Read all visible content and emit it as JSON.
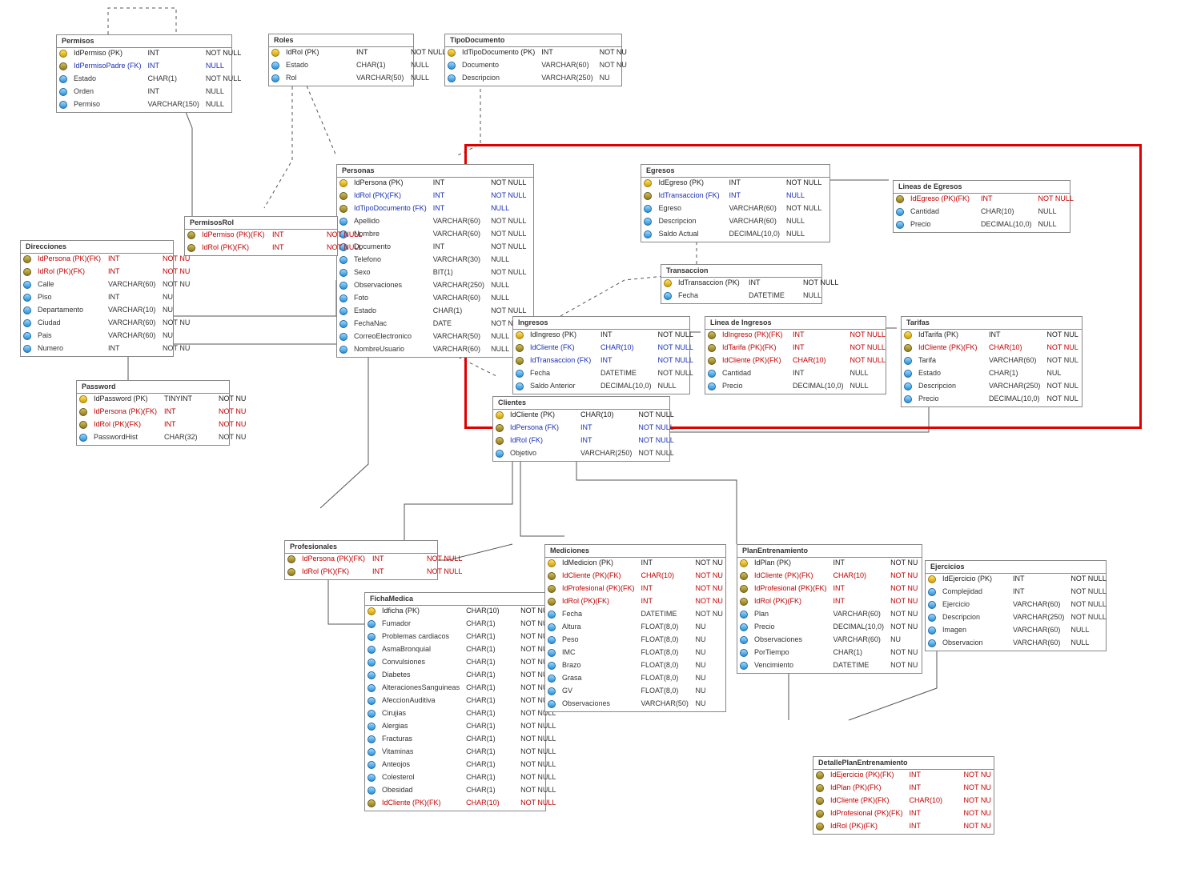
{
  "t": {
    "permisos": {
      "name": "Permisos",
      "c": [
        {
          "k": "pk",
          "n": "IdPermiso (PK)",
          "t": "INT",
          "x": "NOT NULL"
        },
        {
          "k": "fk",
          "n": "IdPermisoPadre (FK)",
          "t": "INT",
          "x": "NULL"
        },
        {
          "k": "a",
          "n": "Estado",
          "t": "CHAR(1)",
          "x": "NOT NULL"
        },
        {
          "k": "a",
          "n": "Orden",
          "t": "INT",
          "x": "NULL"
        },
        {
          "k": "a",
          "n": "Permiso",
          "t": "VARCHAR(150)",
          "x": "NULL"
        }
      ]
    },
    "roles": {
      "name": "Roles",
      "c": [
        {
          "k": "pk",
          "n": "IdRol (PK)",
          "t": "INT",
          "x": "NOT NULL"
        },
        {
          "k": "a",
          "n": "Estado",
          "t": "CHAR(1)",
          "x": "NULL"
        },
        {
          "k": "a",
          "n": "Rol",
          "t": "VARCHAR(50)",
          "x": "NULL"
        }
      ]
    },
    "tipodocumento": {
      "name": "TipoDocumento",
      "c": [
        {
          "k": "pk",
          "n": "IdTipoDocumento (PK)",
          "t": "INT",
          "x": "NOT NU"
        },
        {
          "k": "a",
          "n": "Documento",
          "t": "VARCHAR(60)",
          "x": "NOT NU"
        },
        {
          "k": "a",
          "n": "Descripcion",
          "t": "VARCHAR(250)",
          "x": "NU"
        }
      ]
    },
    "personas": {
      "name": "Personas",
      "c": [
        {
          "k": "pk",
          "n": "IdPersona (PK)",
          "t": "INT",
          "x": "NOT NULL"
        },
        {
          "k": "fk",
          "n": "IdRol (PK)(FK)",
          "t": "INT",
          "x": "NOT NULL"
        },
        {
          "k": "fk",
          "n": "IdTipoDocumento (FK)",
          "t": "INT",
          "x": "NULL"
        },
        {
          "k": "a",
          "n": "Apellido",
          "t": "VARCHAR(60)",
          "x": "NOT NULL"
        },
        {
          "k": "a",
          "n": "Nombre",
          "t": "VARCHAR(60)",
          "x": "NOT NULL"
        },
        {
          "k": "a",
          "n": "Documento",
          "t": "INT",
          "x": "NOT NULL"
        },
        {
          "k": "a",
          "n": "Telefono",
          "t": "VARCHAR(30)",
          "x": "NULL"
        },
        {
          "k": "a",
          "n": "Sexo",
          "t": "BIT(1)",
          "x": "NOT NULL"
        },
        {
          "k": "a",
          "n": "Observaciones",
          "t": "VARCHAR(250)",
          "x": "NULL"
        },
        {
          "k": "a",
          "n": "Foto",
          "t": "VARCHAR(60)",
          "x": "NULL"
        },
        {
          "k": "a",
          "n": "Estado",
          "t": "CHAR(1)",
          "x": "NOT NULL"
        },
        {
          "k": "a",
          "n": "FechaNac",
          "t": "DATE",
          "x": "NOT NULL"
        },
        {
          "k": "a",
          "n": "CorreoElectronico",
          "t": "VARCHAR(50)",
          "x": "NULL"
        },
        {
          "k": "a",
          "n": "NombreUsuario",
          "t": "VARCHAR(60)",
          "x": "NULL"
        }
      ]
    },
    "permisosrol": {
      "name": "PermisosRol",
      "c": [
        {
          "k": "fr",
          "n": "IdPermiso (PK)(FK)",
          "t": "INT",
          "x": "NOT NULL"
        },
        {
          "k": "fr",
          "n": "IdRol (PK)(FK)",
          "t": "INT",
          "x": "NOT NULL"
        }
      ]
    },
    "direcciones": {
      "name": "Direcciones",
      "c": [
        {
          "k": "fr",
          "n": "IdPersona (PK)(FK)",
          "t": "INT",
          "x": "NOT NU"
        },
        {
          "k": "fr",
          "n": "IdRol (PK)(FK)",
          "t": "INT",
          "x": "NOT NU"
        },
        {
          "k": "a",
          "n": "Calle",
          "t": "VARCHAR(60)",
          "x": "NOT NU"
        },
        {
          "k": "a",
          "n": "Piso",
          "t": "INT",
          "x": "NU"
        },
        {
          "k": "a",
          "n": "Departamento",
          "t": "VARCHAR(10)",
          "x": "NU"
        },
        {
          "k": "a",
          "n": "Ciudad",
          "t": "VARCHAR(60)",
          "x": "NOT NU"
        },
        {
          "k": "a",
          "n": "Pais",
          "t": "VARCHAR(60)",
          "x": "NU"
        },
        {
          "k": "a",
          "n": "Numero",
          "t": "INT",
          "x": "NOT NU"
        }
      ]
    },
    "password": {
      "name": "Password",
      "c": [
        {
          "k": "pk",
          "n": "IdPassword (PK)",
          "t": "TINYINT",
          "x": "NOT NU"
        },
        {
          "k": "fr",
          "n": "IdPersona (PK)(FK)",
          "t": "INT",
          "x": "NOT NU"
        },
        {
          "k": "fr",
          "n": "IdRol (PK)(FK)",
          "t": "INT",
          "x": "NOT NU"
        },
        {
          "k": "a",
          "n": "PasswordHist",
          "t": "CHAR(32)",
          "x": "NOT NU"
        }
      ]
    },
    "egresos": {
      "name": "Egresos",
      "c": [
        {
          "k": "pk",
          "n": "IdEgreso (PK)",
          "t": "INT",
          "x": "NOT NULL"
        },
        {
          "k": "fk",
          "n": "IdTransaccion (FK)",
          "t": "INT",
          "x": "NULL"
        },
        {
          "k": "a",
          "n": "Egreso",
          "t": "VARCHAR(60)",
          "x": "NOT NULL"
        },
        {
          "k": "a",
          "n": "Descripcion",
          "t": "VARCHAR(60)",
          "x": "NULL"
        },
        {
          "k": "a",
          "n": "Saldo Actual",
          "t": "DECIMAL(10,0)",
          "x": "NULL"
        }
      ]
    },
    "lineasegresos": {
      "name": "Lineas de Egresos",
      "c": [
        {
          "k": "fr",
          "n": "IdEgreso (PK)(FK)",
          "t": "INT",
          "x": "NOT NULL"
        },
        {
          "k": "a",
          "n": "Cantidad",
          "t": "CHAR(10)",
          "x": "NULL"
        },
        {
          "k": "a",
          "n": "Precio",
          "t": "DECIMAL(10,0)",
          "x": "NULL"
        }
      ]
    },
    "transaccion": {
      "name": "Transaccion",
      "c": [
        {
          "k": "pk",
          "n": "IdTransaccion (PK)",
          "t": "INT",
          "x": "NOT NULL"
        },
        {
          "k": "a",
          "n": "Fecha",
          "t": "DATETIME",
          "x": "NULL"
        }
      ]
    },
    "ingresos": {
      "name": "Ingresos",
      "c": [
        {
          "k": "pk",
          "n": "IdIngreso (PK)",
          "t": "INT",
          "x": "NOT NULL"
        },
        {
          "k": "fk",
          "n": "IdCliente (FK)",
          "t": "CHAR(10)",
          "x": "NOT NULL"
        },
        {
          "k": "fk",
          "n": "IdTransaccion (FK)",
          "t": "INT",
          "x": "NOT NULL"
        },
        {
          "k": "a",
          "n": "Fecha",
          "t": "DATETIME",
          "x": "NOT NULL"
        },
        {
          "k": "a",
          "n": "Saldo Anterior",
          "t": "DECIMAL(10,0)",
          "x": "NULL"
        }
      ]
    },
    "lineaingresos": {
      "name": "Linea de Ingresos",
      "c": [
        {
          "k": "fr",
          "n": "IdIngreso (PK)(FK)",
          "t": "INT",
          "x": "NOT NULL"
        },
        {
          "k": "fr",
          "n": "IdTarifa (PK)(FK)",
          "t": "INT",
          "x": "NOT NULL"
        },
        {
          "k": "fr",
          "n": "IdCliente (PK)(FK)",
          "t": "CHAR(10)",
          "x": "NOT NULL"
        },
        {
          "k": "a",
          "n": "Cantidad",
          "t": "INT",
          "x": "NULL"
        },
        {
          "k": "a",
          "n": "Precio",
          "t": "DECIMAL(10,0)",
          "x": "NULL"
        }
      ]
    },
    "tarifas": {
      "name": "Tarifas",
      "c": [
        {
          "k": "pk",
          "n": "IdTarifa (PK)",
          "t": "INT",
          "x": "NOT NUL"
        },
        {
          "k": "fr",
          "n": "IdCliente (PK)(FK)",
          "t": "CHAR(10)",
          "x": "NOT NUL"
        },
        {
          "k": "a",
          "n": "Tarifa",
          "t": "VARCHAR(60)",
          "x": "NOT NUL"
        },
        {
          "k": "a",
          "n": "Estado",
          "t": "CHAR(1)",
          "x": "NUL"
        },
        {
          "k": "a",
          "n": "Descripcion",
          "t": "VARCHAR(250)",
          "x": "NOT NUL"
        },
        {
          "k": "a",
          "n": "Precio",
          "t": "DECIMAL(10,0)",
          "x": "NOT NUL"
        }
      ]
    },
    "clientes": {
      "name": "Clientes",
      "c": [
        {
          "k": "pk",
          "n": "IdCliente (PK)",
          "t": "CHAR(10)",
          "x": "NOT NULL"
        },
        {
          "k": "fk",
          "n": "IdPersona (FK)",
          "t": "INT",
          "x": "NOT NULL"
        },
        {
          "k": "fk",
          "n": "IdRol (FK)",
          "t": "INT",
          "x": "NOT NULL"
        },
        {
          "k": "a",
          "n": "Objetivo",
          "t": "VARCHAR(250)",
          "x": "NOT NULL"
        }
      ]
    },
    "profesionales": {
      "name": "Profesionales",
      "c": [
        {
          "k": "fr",
          "n": "IdPersona (PK)(FK)",
          "t": "INT",
          "x": "NOT NULL"
        },
        {
          "k": "fr",
          "n": "IdRol (PK)(FK)",
          "t": "INT",
          "x": "NOT NULL"
        }
      ]
    },
    "fichamedica": {
      "name": "FichaMedica",
      "c": [
        {
          "k": "pk",
          "n": "Idficha (PK)",
          "t": "CHAR(10)",
          "x": "NOT NULL"
        },
        {
          "k": "a",
          "n": "Fumador",
          "t": "CHAR(1)",
          "x": "NOT NULL"
        },
        {
          "k": "a",
          "n": "Problemas cardiacos",
          "t": "CHAR(1)",
          "x": "NOT NULL"
        },
        {
          "k": "a",
          "n": "AsmaBronquial",
          "t": "CHAR(1)",
          "x": "NOT NULL"
        },
        {
          "k": "a",
          "n": "Convulsiones",
          "t": "CHAR(1)",
          "x": "NOT NULL"
        },
        {
          "k": "a",
          "n": "Diabetes",
          "t": "CHAR(1)",
          "x": "NOT NULL"
        },
        {
          "k": "a",
          "n": "AlteracionesSanguineas",
          "t": "CHAR(1)",
          "x": "NOT NULL"
        },
        {
          "k": "a",
          "n": "AfeccionAuditiva",
          "t": "CHAR(1)",
          "x": "NOT NULL"
        },
        {
          "k": "a",
          "n": "Cirujias",
          "t": "CHAR(1)",
          "x": "NOT NULL"
        },
        {
          "k": "a",
          "n": "Alergias",
          "t": "CHAR(1)",
          "x": "NOT NULL"
        },
        {
          "k": "a",
          "n": "Fracturas",
          "t": "CHAR(1)",
          "x": "NOT NULL"
        },
        {
          "k": "a",
          "n": "Vitaminas",
          "t": "CHAR(1)",
          "x": "NOT NULL"
        },
        {
          "k": "a",
          "n": "Anteojos",
          "t": "CHAR(1)",
          "x": "NOT NULL"
        },
        {
          "k": "a",
          "n": "Colesterol",
          "t": "CHAR(1)",
          "x": "NOT NULL"
        },
        {
          "k": "a",
          "n": "Obesidad",
          "t": "CHAR(1)",
          "x": "NOT NULL"
        },
        {
          "k": "fr",
          "n": "IdCliente (PK)(FK)",
          "t": "CHAR(10)",
          "x": "NOT NULL"
        }
      ]
    },
    "mediciones": {
      "name": "Mediciones",
      "c": [
        {
          "k": "pk",
          "n": "IdMedicion (PK)",
          "t": "INT",
          "x": "NOT NU"
        },
        {
          "k": "fr",
          "n": "IdCliente (PK)(FK)",
          "t": "CHAR(10)",
          "x": "NOT NU"
        },
        {
          "k": "fr",
          "n": "IdProfesional (PK)(FK)",
          "t": "INT",
          "x": "NOT NU"
        },
        {
          "k": "fr",
          "n": "IdRol (PK)(FK)",
          "t": "INT",
          "x": "NOT NU"
        },
        {
          "k": "a",
          "n": "Fecha",
          "t": "DATETIME",
          "x": "NOT NU"
        },
        {
          "k": "a",
          "n": "Altura",
          "t": "FLOAT(8,0)",
          "x": "NU"
        },
        {
          "k": "a",
          "n": "Peso",
          "t": "FLOAT(8,0)",
          "x": "NU"
        },
        {
          "k": "a",
          "n": "IMC",
          "t": "FLOAT(8,0)",
          "x": "NU"
        },
        {
          "k": "a",
          "n": "Brazo",
          "t": "FLOAT(8,0)",
          "x": "NU"
        },
        {
          "k": "a",
          "n": "Grasa",
          "t": "FLOAT(8,0)",
          "x": "NU"
        },
        {
          "k": "a",
          "n": "GV",
          "t": "FLOAT(8,0)",
          "x": "NU"
        },
        {
          "k": "a",
          "n": "Observaciones",
          "t": "VARCHAR(50)",
          "x": "NU"
        }
      ]
    },
    "planentrenamiento": {
      "name": "PlanEntrenamiento",
      "c": [
        {
          "k": "pk",
          "n": "IdPlan (PK)",
          "t": "INT",
          "x": "NOT NU"
        },
        {
          "k": "fr",
          "n": "IdCliente (PK)(FK)",
          "t": "CHAR(10)",
          "x": "NOT NU"
        },
        {
          "k": "fr",
          "n": "IdProfesional (PK)(FK)",
          "t": "INT",
          "x": "NOT NU"
        },
        {
          "k": "fr",
          "n": "IdRol (PK)(FK)",
          "t": "INT",
          "x": "NOT NU"
        },
        {
          "k": "a",
          "n": "Plan",
          "t": "VARCHAR(60)",
          "x": "NOT NU"
        },
        {
          "k": "a",
          "n": "Precio",
          "t": "DECIMAL(10,0)",
          "x": "NOT NU"
        },
        {
          "k": "a",
          "n": "Observaciones",
          "t": "VARCHAR(60)",
          "x": "NU"
        },
        {
          "k": "a",
          "n": "PorTiempo",
          "t": "CHAR(1)",
          "x": "NOT NU"
        },
        {
          "k": "a",
          "n": "Vencimiento",
          "t": "DATETIME",
          "x": "NOT NU"
        }
      ]
    },
    "ejercicios": {
      "name": "Ejercicios",
      "c": [
        {
          "k": "pk",
          "n": "IdEjercicio (PK)",
          "t": "INT",
          "x": "NOT NULL"
        },
        {
          "k": "a",
          "n": "Complejidad",
          "t": "INT",
          "x": "NOT NULL"
        },
        {
          "k": "a",
          "n": "Ejercicio",
          "t": "VARCHAR(60)",
          "x": "NOT NULL"
        },
        {
          "k": "a",
          "n": "Descripcion",
          "t": "VARCHAR(250)",
          "x": "NOT NULL"
        },
        {
          "k": "a",
          "n": "Imagen",
          "t": "VARCHAR(60)",
          "x": "NULL"
        },
        {
          "k": "a",
          "n": "Observacion",
          "t": "VARCHAR(60)",
          "x": "NULL"
        }
      ]
    },
    "detalleplanentrenamiento": {
      "name": "DetallePlanEntrenamiento",
      "c": [
        {
          "k": "fr",
          "n": "IdEjercicio (PK)(FK)",
          "t": "INT",
          "x": "NOT NU"
        },
        {
          "k": "fr",
          "n": "IdPlan (PK)(FK)",
          "t": "INT",
          "x": "NOT NU"
        },
        {
          "k": "fr",
          "n": "IdCliente (PK)(FK)",
          "t": "CHAR(10)",
          "x": "NOT NU"
        },
        {
          "k": "fr",
          "n": "IdProfesional (PK)(FK)",
          "t": "INT",
          "x": "NOT NU"
        },
        {
          "k": "fr",
          "n": "IdRol (PK)(FK)",
          "t": "INT",
          "x": "NOT NU"
        }
      ]
    }
  }
}
